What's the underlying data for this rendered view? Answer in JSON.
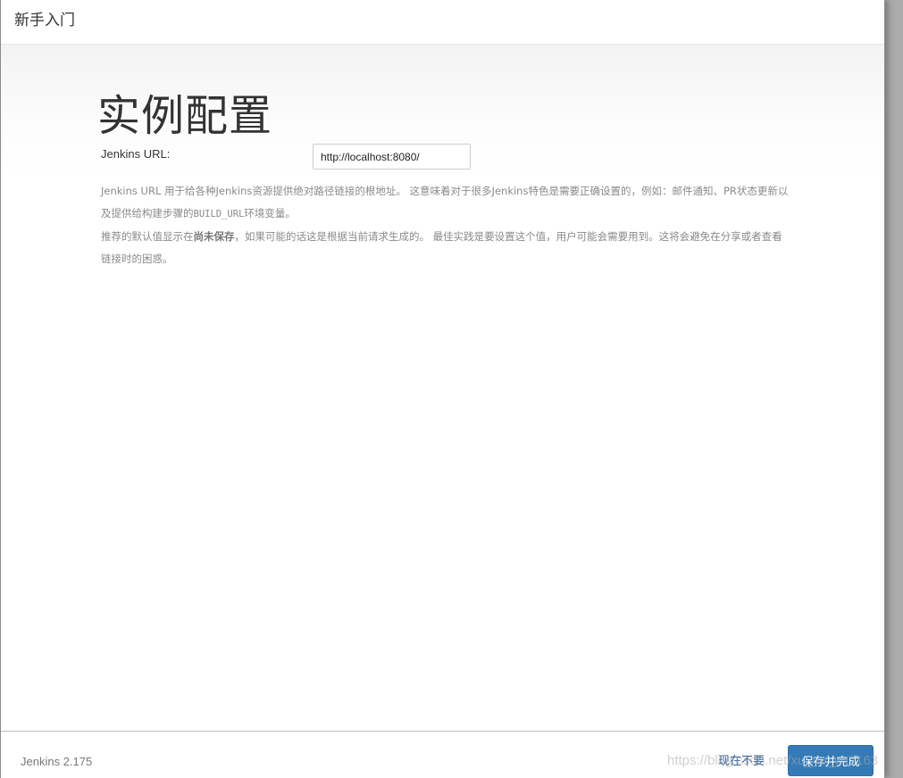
{
  "header": {
    "title": "新手入门"
  },
  "main": {
    "page_title": "实例配置",
    "url_label": "Jenkins URL:",
    "url_value": "http://localhost:8080/",
    "help": {
      "line1": "Jenkins URL 用于给各种Jenkins资源提供绝对路径链接的根地址。 这意味着对于很多Jenkins特色是需要正确设置的，例如：邮件通知、PR状态更新以及提供给构建步骤的",
      "env_var": "BUILD_URL",
      "line1_tail": "环境变量。",
      "line2_pre": "推荐的默认值显示在",
      "line2_bold": "尚未保存",
      "line2_post": "，如果可能的话这是根据当前请求生成的。 最佳实践是要设置这个值，用户可能会需要用到。这将会避免在分享或者查看链接时的困惑。"
    }
  },
  "footer": {
    "version": "Jenkins 2.175",
    "skip_label": "现在不要",
    "save_label": "保存并完成",
    "watermark": "https://blog.csdn.net/xu_yu_yu7163"
  }
}
